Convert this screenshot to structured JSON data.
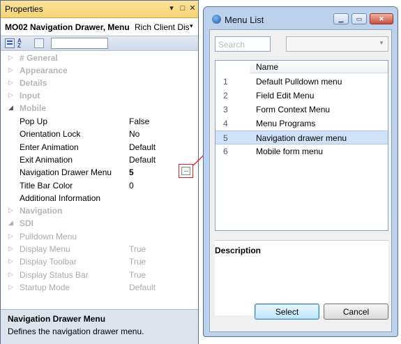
{
  "properties": {
    "title": "Properties",
    "object_name": "MO02 Navigation Drawer, Menu",
    "object_class": "Rich Client Dis",
    "rows": [
      {
        "name": "# General",
        "kind": "category",
        "state": "collapsed"
      },
      {
        "name": "Appearance",
        "kind": "category",
        "state": "collapsed"
      },
      {
        "name": "Details",
        "kind": "category",
        "state": "collapsed"
      },
      {
        "name": "Input",
        "kind": "category",
        "state": "collapsed"
      },
      {
        "name": "Mobile",
        "kind": "category",
        "state": "expanded"
      },
      {
        "name": "Pop Up",
        "value": "False"
      },
      {
        "name": "Orientation Lock",
        "value": "No"
      },
      {
        "name": "Enter Animation",
        "value": "Default"
      },
      {
        "name": "Exit Animation",
        "value": "Default"
      },
      {
        "name": "Navigation Drawer Menu",
        "value": "5"
      },
      {
        "name": "Title Bar Color",
        "value": "0"
      },
      {
        "name": "Additional Information",
        "value": ""
      },
      {
        "name": "Navigation",
        "kind": "category",
        "state": "collapsed"
      },
      {
        "name": "SDI",
        "kind": "category",
        "state": "expanded"
      },
      {
        "name": "Pulldown Menu",
        "value": "",
        "disabled": true
      },
      {
        "name": "Display Menu",
        "value": "True",
        "disabled": true
      },
      {
        "name": "Display Toolbar",
        "value": "True",
        "disabled": true
      },
      {
        "name": "Display Status Bar",
        "value": "True",
        "disabled": true
      },
      {
        "name": "Startup Mode",
        "value": "Default",
        "disabled": true
      }
    ],
    "ellipsis_label": "...",
    "description_title": "Navigation Drawer Menu",
    "description_text": "Defines the navigation drawer menu."
  },
  "dialog": {
    "title": "Menu List",
    "search_placeholder": "Search",
    "column_header": "Name",
    "items": [
      {
        "num": "1",
        "name": "Default Pulldown menu"
      },
      {
        "num": "2",
        "name": "Field Edit Menu"
      },
      {
        "num": "3",
        "name": "Form Context Menu"
      },
      {
        "num": "4",
        "name": "Menu Programs"
      },
      {
        "num": "5",
        "name": "Navigation drawer menu",
        "selected": true
      },
      {
        "num": "6",
        "name": "Mobile form menu"
      }
    ],
    "description_label": "Description",
    "select_label": "Select",
    "cancel_label": "Cancel"
  },
  "colors": {
    "title_bar_active": "#f5d376",
    "selection": "#cfe2f7",
    "highlight_box": "#e02020"
  }
}
